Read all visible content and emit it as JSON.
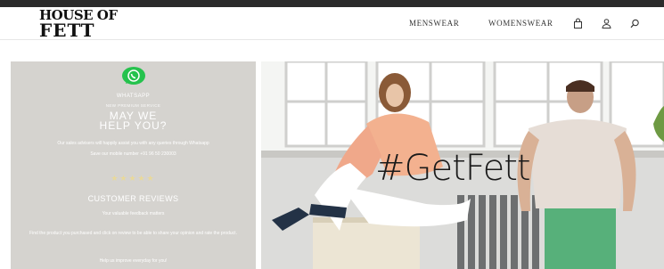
{
  "header": {
    "logo_line1": "HOUSE OF",
    "logo_line2": "FETT",
    "nav": [
      {
        "label": "MENSWEAR"
      },
      {
        "label": "WOMENSWEAR"
      }
    ],
    "icons": [
      "shopping-bag-icon",
      "user-icon",
      "search-icon"
    ]
  },
  "whatsapp_panel": {
    "title": "WHATSAPP",
    "subtitle": "NEW PREMIUM SERVICE",
    "heading_line1": "MAY WE",
    "heading_line2": "HELP YOU?",
    "description": "Our sales advisers will happily assist you with any queries through Whatsapp",
    "number_text": "Save our mobile number +91 96 50 230003",
    "stars": "★★★★★",
    "reviews_heading": "CUSTOMER REVIEWS",
    "reviews_sub": "Your valuable feedback matters",
    "reviews_text": "Find the product you purchased and click on review to be able to share your opinion and rate the product.",
    "reviews_footer": "Help us improve everyday for you!",
    "colors": {
      "panel_bg": "#d5d3cf",
      "whatsapp_green": "#25c24d"
    }
  },
  "hero": {
    "hashtag": "#GetFett"
  }
}
